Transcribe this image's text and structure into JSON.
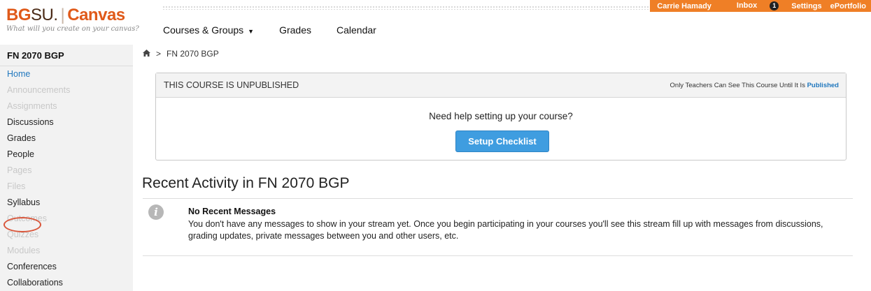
{
  "header": {
    "logo": {
      "bg": "BG",
      "su": "SU.",
      "separator": "|",
      "canvas": "Canvas"
    },
    "tagline": "What will you create on your canvas?",
    "nav": [
      {
        "label": "Courses & Groups",
        "caret": "▼"
      },
      {
        "label": "Grades"
      },
      {
        "label": "Calendar"
      }
    ],
    "user_bar": {
      "user_name": "Carrie Hamady",
      "inbox_label": "Inbox",
      "inbox_count": "1",
      "settings_label": "Settings",
      "eportfolio_label": "ePortfolio"
    },
    "accent_color": "#ef7f26"
  },
  "sidebar": {
    "course_name": "FN 2070 BGP",
    "items": [
      {
        "label": "Home",
        "state": "active"
      },
      {
        "label": "Announcements",
        "state": "disabled"
      },
      {
        "label": "Assignments",
        "state": "disabled"
      },
      {
        "label": "Discussions",
        "state": "enabled"
      },
      {
        "label": "Grades",
        "state": "enabled"
      },
      {
        "label": "People",
        "state": "enabled"
      },
      {
        "label": "Pages",
        "state": "disabled"
      },
      {
        "label": "Files",
        "state": "disabled"
      },
      {
        "label": "Syllabus",
        "state": "enabled"
      },
      {
        "label": "Outcomes",
        "state": "disabled"
      },
      {
        "label": "Quizzes",
        "state": "disabled"
      },
      {
        "label": "Modules",
        "state": "disabled"
      },
      {
        "label": "Conferences",
        "state": "enabled"
      },
      {
        "label": "Collaborations",
        "state": "enabled"
      }
    ]
  },
  "breadcrumb": {
    "home_icon": "home-icon",
    "separator": ">",
    "course": "FN 2070 BGP"
  },
  "publish_notice": {
    "title": "THIS COURSE IS UNPUBLISHED",
    "note_prefix": "Only Teachers Can See This Course Until It Is",
    "note_link": "Published",
    "help_text": "Need help setting up your course?",
    "button_label": "Setup Checklist"
  },
  "recent_activity": {
    "title": "Recent Activity in FN 2070 BGP",
    "icon": "info-icon",
    "icon_glyph": "i",
    "message_title": "No Recent Messages",
    "message_body": "You don't have any messages to show in your stream yet. Once you begin participating in your courses you'll see this stream fill up with messages from discussions, grading updates, private messages between you and other users, etc."
  }
}
